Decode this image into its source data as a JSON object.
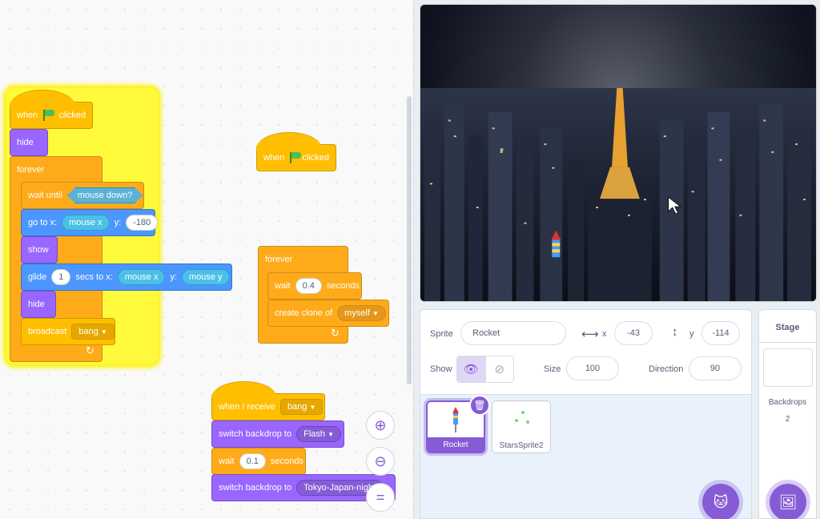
{
  "scripts": {
    "s1": {
      "hat_when": "when",
      "hat_clicked": "clicked",
      "hide": "hide",
      "forever": "forever",
      "wait_until": "wait until",
      "mouse_down": "mouse down?",
      "goto_label": "go to x:",
      "goto_x": "mouse x",
      "goto_y_label": "y:",
      "goto_y": "-180",
      "show": "show",
      "glide_label": "glide",
      "glide_secs": "1",
      "glide_to": "secs to x:",
      "glide_x": "mouse x",
      "glide_y_label": "y:",
      "glide_y": "mouse y",
      "hide2": "hide",
      "broadcast": "broadcast",
      "broadcast_msg": "bang"
    },
    "s2": {
      "hat_when": "when",
      "hat_clicked": "clicked"
    },
    "s3": {
      "forever": "forever",
      "wait": "wait",
      "wait_val": "0.4",
      "seconds": "seconds",
      "clone": "create clone of",
      "clone_target": "myself"
    },
    "s4": {
      "receive": "when I receive",
      "receive_msg": "bang",
      "switch1": "switch backdrop to",
      "switch1_val": "Flash",
      "wait": "wait",
      "wait_val": "0.1",
      "seconds": "seconds",
      "switch2": "switch backdrop to",
      "switch2_val": "Tokyo-Japan-night"
    }
  },
  "zoom": {
    "in": "⊕",
    "out": "⊖",
    "reset": "="
  },
  "sprite_info": {
    "sprite_label": "Sprite",
    "sprite_name": "Rocket",
    "x_label": "x",
    "x_value": "-43",
    "y_label": "y",
    "y_value": "-114",
    "show_label": "Show",
    "size_label": "Size",
    "size_value": "100",
    "direction_label": "Direction",
    "direction_value": "90"
  },
  "sprites": [
    {
      "name": "Rocket",
      "selected": true
    },
    {
      "name": "StarsSprite2",
      "selected": false
    }
  ],
  "stage_pane": {
    "title": "Stage",
    "backdrops_label": "Backdrops",
    "backdrops_count": "2"
  },
  "colors": {
    "events": "#ffbf00",
    "control": "#ffab19",
    "looks": "#9966ff",
    "motion": "#4c97ff",
    "sensing": "#5cb1d6",
    "accent": "#855cd6"
  }
}
